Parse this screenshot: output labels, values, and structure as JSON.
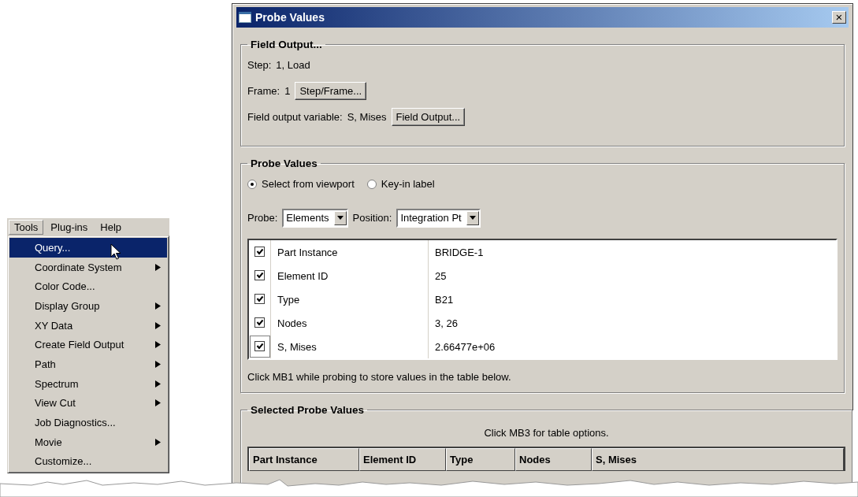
{
  "menu": {
    "bar": [
      {
        "label": "Tools",
        "selected": true
      },
      {
        "label": "Plug-ins",
        "selected": false
      },
      {
        "label": "Help",
        "selected": false
      }
    ],
    "items": [
      {
        "label": "Query...",
        "submenu": false,
        "selected": true
      },
      {
        "label": "Coordinate System",
        "submenu": true,
        "selected": false
      },
      {
        "label": "Color Code...",
        "submenu": false,
        "selected": false
      },
      {
        "label": "Display Group",
        "submenu": true,
        "selected": false
      },
      {
        "label": "XY Data",
        "submenu": true,
        "selected": false
      },
      {
        "label": "Create Field Output",
        "submenu": true,
        "selected": false
      },
      {
        "label": "Path",
        "submenu": true,
        "selected": false
      },
      {
        "label": "Spectrum",
        "submenu": true,
        "selected": false
      },
      {
        "label": "View Cut",
        "submenu": true,
        "selected": false
      },
      {
        "label": "Job Diagnostics...",
        "submenu": false,
        "selected": false
      },
      {
        "label": "Movie",
        "submenu": true,
        "selected": false
      },
      {
        "label": "Customize...",
        "submenu": false,
        "selected": false
      }
    ]
  },
  "dialog": {
    "title": "Probe Values",
    "close": "×",
    "field_output": {
      "title": "Field Output...",
      "step_label": "Step:",
      "step_value": "1, Load",
      "frame_label": "Frame:",
      "frame_value": "1",
      "frame_button": "Step/Frame...",
      "variable_label": "Field output variable:",
      "variable_value": "S, Mises",
      "variable_button": "Field Output..."
    },
    "probe_values": {
      "title": "Probe Values",
      "radios": [
        {
          "label": "Select from viewport",
          "selected": true
        },
        {
          "label": "Key-in label",
          "selected": false
        }
      ],
      "probe_label": "Probe:",
      "probe_value": "Elements",
      "position_label": "Position:",
      "position_value": "Integration Pt",
      "rows": [
        {
          "label": "Part Instance",
          "value": "BRIDGE-1",
          "checked": true,
          "focused": false
        },
        {
          "label": "Element ID",
          "value": "25",
          "checked": true,
          "focused": false
        },
        {
          "label": "Type",
          "value": "B21",
          "checked": true,
          "focused": false
        },
        {
          "label": "Nodes",
          "value": "3, 26",
          "checked": true,
          "focused": false
        },
        {
          "label": "S, Mises",
          "value": "2.66477e+06",
          "checked": true,
          "focused": true
        }
      ],
      "hint": "Click MB1 while probing to store values in the table below."
    },
    "selected_probe_values": {
      "title": "Selected Probe Values",
      "hint": "Click MB3 for table options.",
      "columns": [
        "Part Instance",
        "Element ID",
        "Type",
        "Nodes",
        "S, Mises"
      ]
    }
  }
}
